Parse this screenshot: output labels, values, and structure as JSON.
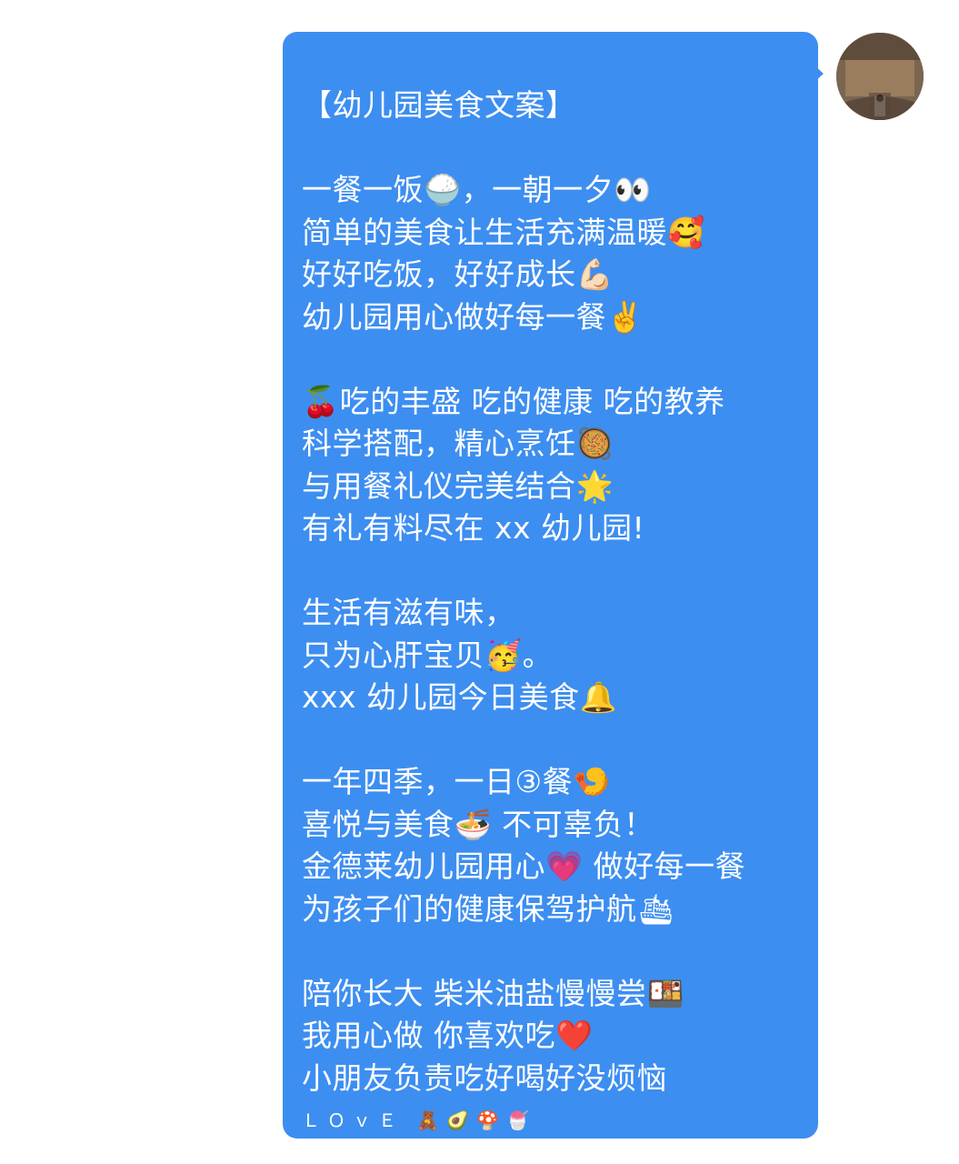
{
  "message": {
    "lines": [
      "【幼儿园美食文案】",
      "",
      "一餐一饭🍚，一朝一夕👀",
      "简单的美食让生活充满温暖🥰",
      "好好吃饭，好好成长💪🏻",
      "幼儿园用心做好每一餐✌️",
      "",
      "🍒吃的丰盛 吃的健康 吃的教养",
      "科学搭配，精心烹饪🥘",
      "与用餐礼仪完美结合🌟",
      "有礼有料尽在 xx 幼儿园!",
      "",
      "生活有滋有味，",
      "只为心肝宝贝🥳。",
      "xxx 幼儿园今日美食🔔",
      "",
      "一年四季，一日③餐🍤",
      "喜悦与美食🍜 不可辜负！",
      "金德莱幼儿园用心💗 做好每一餐",
      "为孩子们的健康保驾护航🛳",
      "",
      "陪你长大  柴米油盐慢慢尝🍱",
      "我用心做   你喜欢吃❤️",
      "小朋友负责吃好喝好没烦恼"
    ],
    "signature": "ＬＯｖＥ 🧸🥑🍄🍧"
  },
  "colors": {
    "bubble": "#3d8ef1",
    "text": "#ffffff",
    "background": "#ffffff"
  },
  "avatar": {
    "icon": "user-avatar"
  }
}
